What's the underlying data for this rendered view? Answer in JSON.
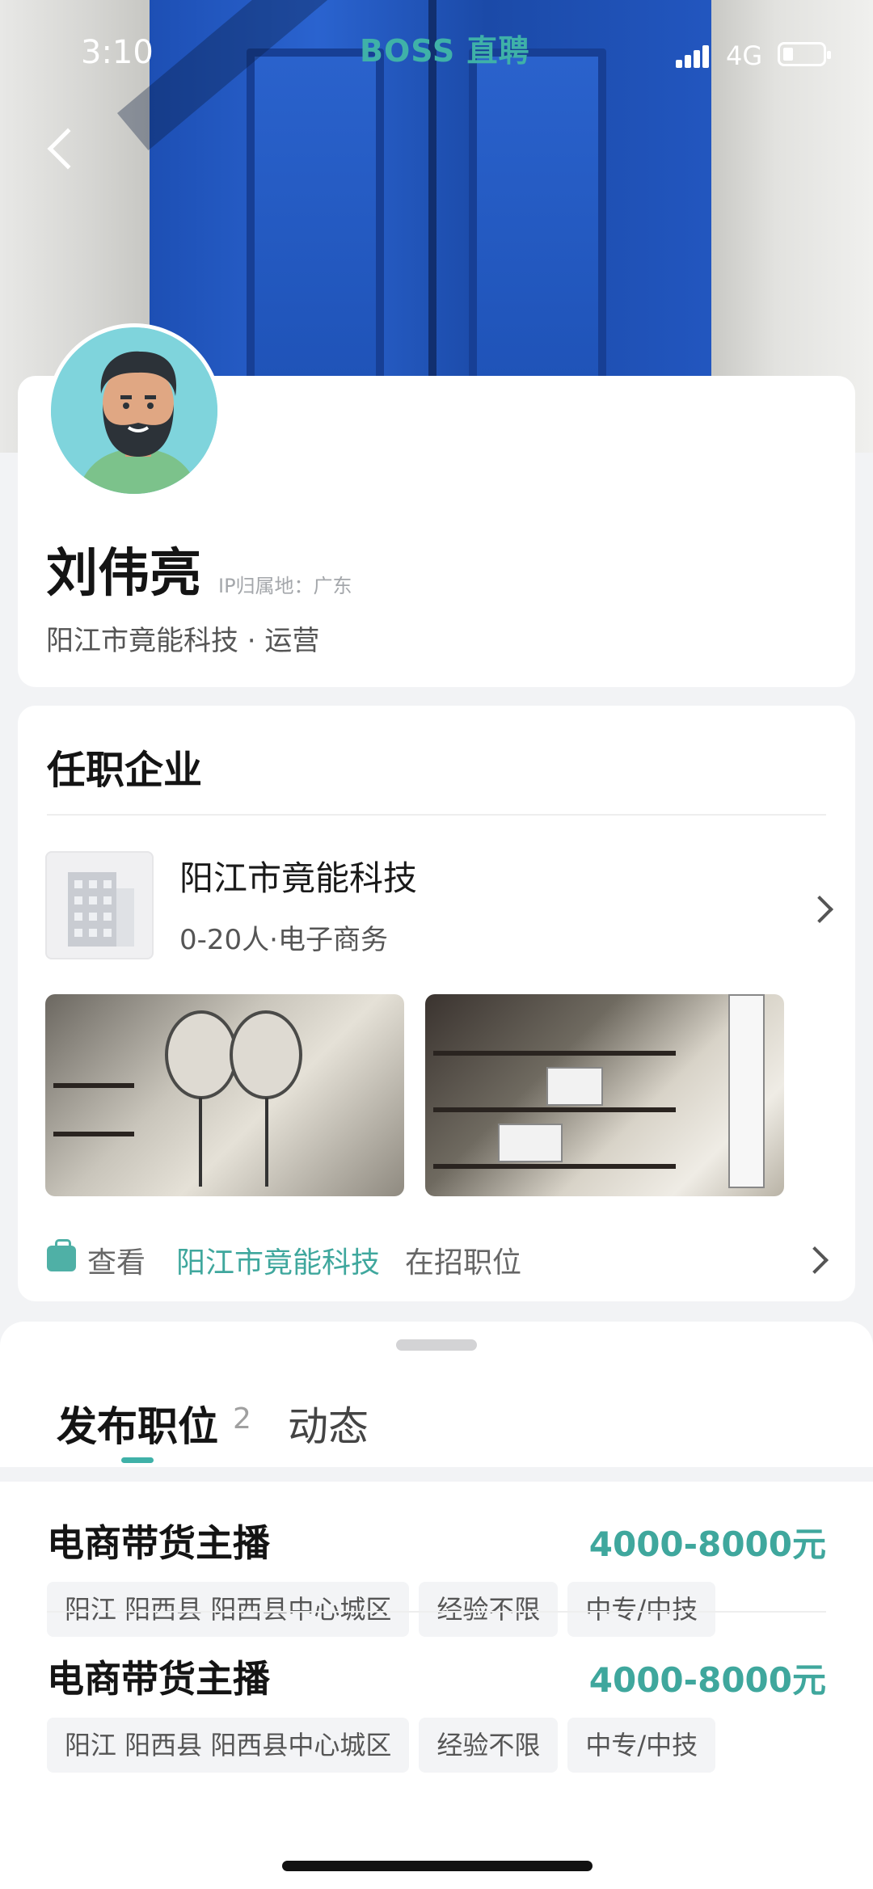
{
  "status_bar": {
    "time": "3:10",
    "brand": "BOSS 直聘",
    "network": "4G"
  },
  "profile": {
    "name": "刘伟亮",
    "ip_location": "IP归属地：广东",
    "subtitle": "阳江市竟能科技 · 运营"
  },
  "company_section": {
    "title": "任职企业",
    "company_name": "阳江市竟能科技",
    "company_meta": "0-20人·电子商务",
    "view_prefix": "查看",
    "view_company": "阳江市竟能科技",
    "view_suffix": "在招职位"
  },
  "tabs": [
    {
      "label": "发布职位",
      "count": "2"
    },
    {
      "label": "动态"
    }
  ],
  "jobs": [
    {
      "title": "电商带货主播",
      "salary": "4000-8000元",
      "tags": [
        "阳江 阳西县 阳西县中心城区",
        "经验不限",
        "中专/中技"
      ]
    },
    {
      "title": "电商带货主播",
      "salary": "4000-8000元",
      "tags": [
        "阳江 阳西县 阳西县中心城区",
        "经验不限",
        "中专/中技"
      ]
    }
  ],
  "colors": {
    "accent": "#3fb1a8",
    "salary": "#3fa79d"
  },
  "icons": [
    "back-arrow-icon",
    "chevron-right-icon",
    "briefcase-icon",
    "company-building-icon",
    "avatar"
  ]
}
